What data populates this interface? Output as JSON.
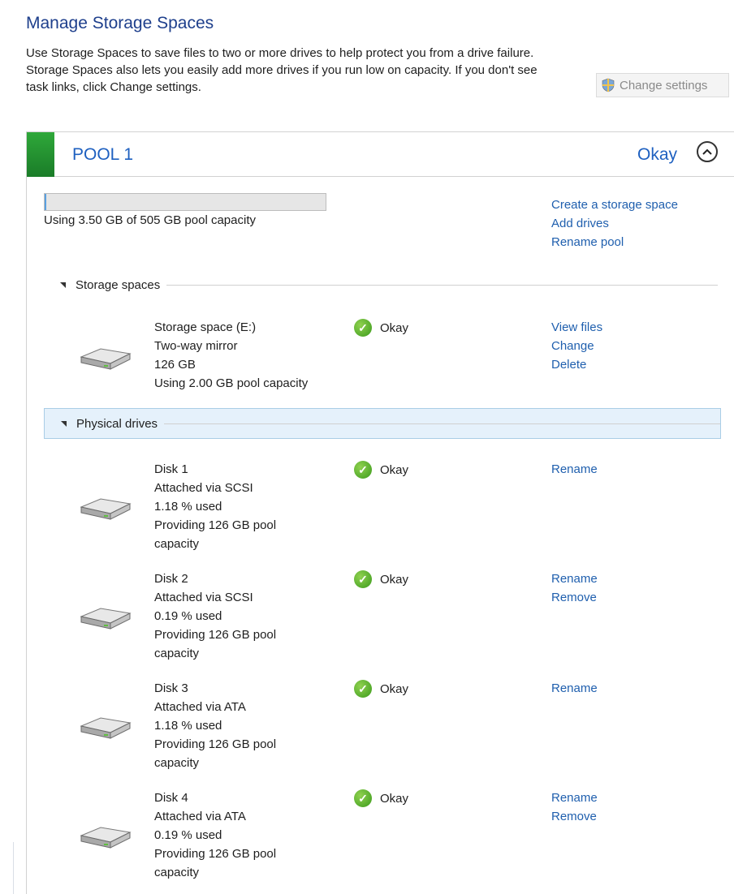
{
  "page": {
    "title": "Manage Storage Spaces",
    "description": "Use Storage Spaces to save files to two or more drives to help protect you from a drive failure. Storage Spaces also lets you easily add more drives if you run low on capacity. If you don't see task links, click Change settings.",
    "change_settings_label": "Change settings"
  },
  "pool": {
    "name": "POOL 1",
    "status": "Okay",
    "capacity_text": "Using 3.50 GB of 505 GB pool capacity",
    "usage_fraction": 0.007,
    "links": [
      "Create a storage space",
      "Add drives",
      "Rename pool"
    ]
  },
  "sections": {
    "storage_spaces": "Storage spaces",
    "physical_drives": "Physical drives"
  },
  "storage_space": {
    "name": "Storage space (E:)",
    "type": "Two-way mirror",
    "size": "126 GB",
    "usage": "Using 2.00 GB pool capacity",
    "status": "Okay",
    "links": [
      "View files",
      "Change",
      "Delete"
    ]
  },
  "drives": [
    {
      "name": "Disk 1",
      "attached": "Attached via SCSI",
      "used": "1.18 % used",
      "providing_1": "Providing 126 GB pool",
      "providing_2": "capacity",
      "status": "Okay",
      "links": [
        "Rename"
      ]
    },
    {
      "name": "Disk 2",
      "attached": "Attached via SCSI",
      "used": "0.19 % used",
      "providing_1": "Providing 126 GB pool",
      "providing_2": "capacity",
      "status": "Okay",
      "links": [
        "Rename",
        "Remove"
      ]
    },
    {
      "name": "Disk 3",
      "attached": "Attached via ATA",
      "used": "1.18 % used",
      "providing_1": "Providing 126 GB pool",
      "providing_2": "capacity",
      "status": "Okay",
      "links": [
        "Rename"
      ]
    },
    {
      "name": "Disk 4",
      "attached": "Attached via ATA",
      "used": "0.19 % used",
      "providing_1": "Providing 126 GB pool",
      "providing_2": "capacity",
      "status": "Okay",
      "links": [
        "Rename",
        "Remove"
      ]
    }
  ],
  "colors": {
    "accent_link": "#1f5fae",
    "pool_green": "#2fa83a",
    "title_blue": "#1e3f8c"
  },
  "icons": {
    "drive": "hard-drive-icon",
    "status": "check-circle-icon",
    "shield": "shield-icon",
    "collapse": "chevron-up-icon"
  }
}
